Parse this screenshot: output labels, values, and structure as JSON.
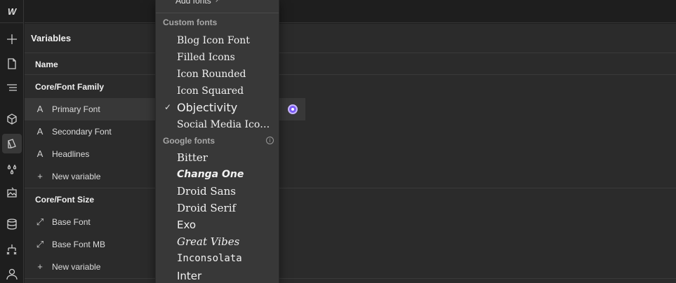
{
  "rail": {
    "logo": "W",
    "icons": [
      "plus-icon",
      "page-icon",
      "navigator-icon",
      "components-icon",
      "style-manager-icon",
      "drops-icon",
      "assets-icon",
      "database-icon",
      "logic-icon",
      "user-icon"
    ]
  },
  "panel": {
    "title": "Variables",
    "column_header": "Name",
    "groups": [
      {
        "name": "Core/Font Family",
        "items": [
          {
            "label": "Primary Font",
            "icon": "font-icon",
            "selected": true
          },
          {
            "label": "Secondary Font",
            "icon": "font-icon"
          },
          {
            "label": "Headlines",
            "icon": "font-icon"
          },
          {
            "label": "New variable",
            "icon": "plus-icon"
          }
        ]
      },
      {
        "name": "Core/Font Size",
        "items": [
          {
            "label": "Base Font",
            "icon": "resize-icon"
          },
          {
            "label": "Base Font MB",
            "icon": "resize-icon"
          },
          {
            "label": "New variable",
            "icon": "plus-icon"
          }
        ]
      }
    ],
    "accent_color": "#7b5cf5"
  },
  "dropdown": {
    "add_fonts": "Add fonts",
    "custom_section": "Custom fonts",
    "custom_fonts": [
      "Blog Icon Font",
      "Filled Icons",
      "Icon Rounded",
      "Icon Squared",
      "Objectivity",
      "Social Media Icon ..."
    ],
    "selected_font": "Objectivity",
    "google_section": "Google fonts",
    "google_fonts": [
      "Bitter",
      "Changa One",
      "Droid Sans",
      "Droid Serif",
      "Exo",
      "Great Vibes",
      "Inconsolata",
      "Inter"
    ]
  }
}
